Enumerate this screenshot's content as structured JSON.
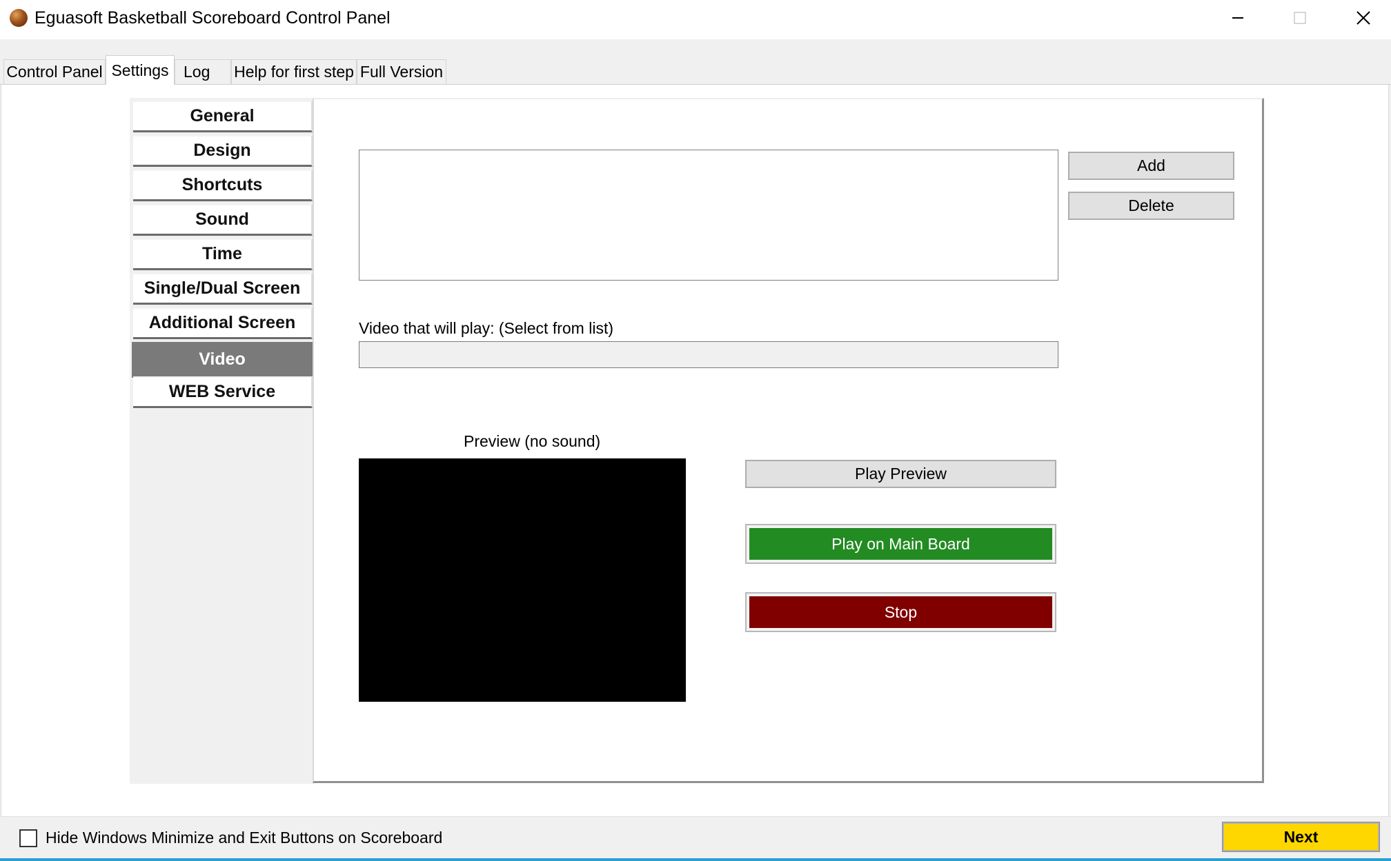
{
  "window": {
    "title": "Eguasoft Basketball Scoreboard Control Panel",
    "icon": "basketball-icon"
  },
  "tabs": [
    {
      "label": "Control Panel",
      "active": false
    },
    {
      "label": "Settings",
      "active": true
    },
    {
      "label": "Log",
      "active": false
    },
    {
      "label": "Help for first step",
      "active": false
    },
    {
      "label": "Full Version",
      "active": false
    }
  ],
  "settings_nav": {
    "items": [
      {
        "label": "General"
      },
      {
        "label": "Design"
      },
      {
        "label": "Shortcuts"
      },
      {
        "label": "Sound"
      },
      {
        "label": "Time"
      },
      {
        "label": "Single/Dual Screen"
      },
      {
        "label": "Additional Screen"
      },
      {
        "label": "Video",
        "active": true
      },
      {
        "label": "WEB Service"
      }
    ]
  },
  "video": {
    "list_items": [],
    "add_label": "Add",
    "delete_label": "Delete",
    "selected_label": "Video that will play: (Select from list)",
    "selected_value": "",
    "preview_label": "Preview (no sound)",
    "play_preview_label": "Play Preview",
    "play_main_label": "Play on Main Board",
    "stop_label": "Stop"
  },
  "footer": {
    "hide_buttons_label": "Hide Windows Minimize and Exit Buttons on Scoreboard",
    "hide_buttons_checked": false,
    "next_label": "Next"
  },
  "colors": {
    "play_main": "#228b22",
    "stop": "#800000",
    "next": "#ffd700",
    "nav_active": "#7a7a7a"
  }
}
